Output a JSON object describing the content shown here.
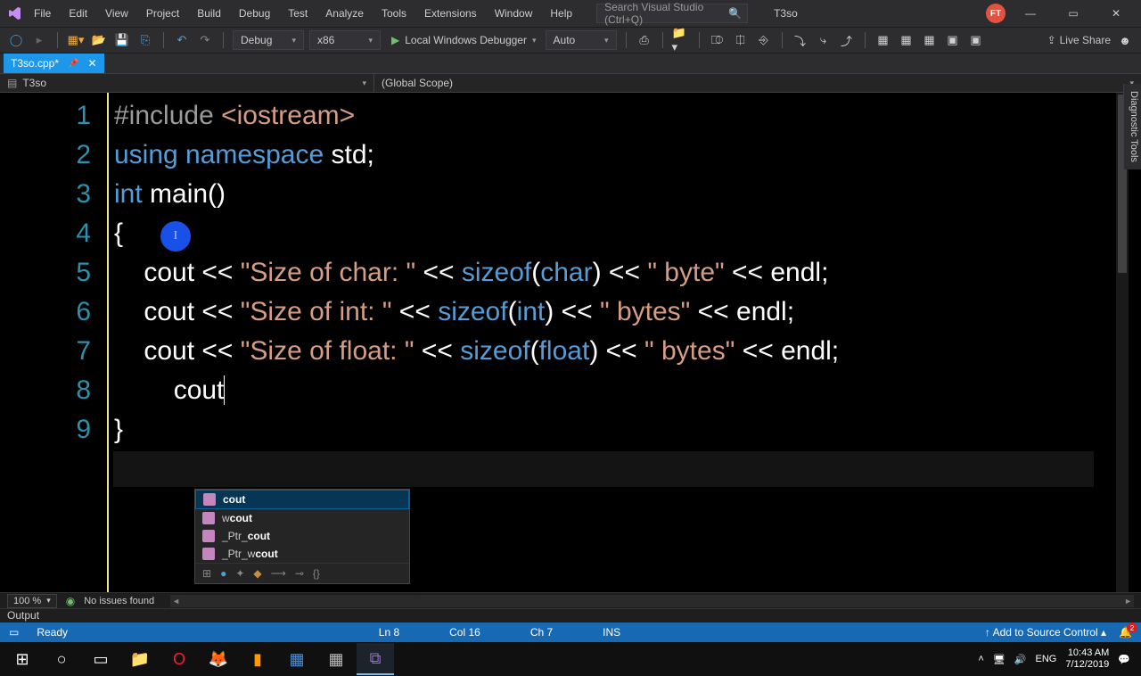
{
  "menu": {
    "items": [
      "File",
      "Edit",
      "View",
      "Project",
      "Build",
      "Debug",
      "Test",
      "Analyze",
      "Tools",
      "Extensions",
      "Window",
      "Help"
    ]
  },
  "search": {
    "placeholder": "Search Visual Studio (Ctrl+Q)"
  },
  "project_name": "T3so",
  "avatar_initials": "FT",
  "toolbar": {
    "config": "Debug",
    "platform": "x86",
    "debugger": "Local Windows Debugger",
    "auto": "Auto",
    "liveshare": "Live Share"
  },
  "tab": {
    "filename": "T3so.cpp*"
  },
  "scope": {
    "project": "T3so",
    "func": "(Global Scope)"
  },
  "gutter": [
    "1",
    "2",
    "3",
    "4",
    "5",
    "6",
    "7",
    "8",
    "9"
  ],
  "code": {
    "l1a": "#include",
    "l1b": " <iostream>",
    "l2a": "using",
    "l2b": " namespace",
    "l2c": " std;",
    "l3a": "int",
    "l3b": " main()",
    "l4": "{",
    "l5i": "    ",
    "l5a": "cout << ",
    "l5s": "\"Size of char: \"",
    "l5b": " << ",
    "l5k": "sizeof",
    "l5c": "(",
    "l5t": "char",
    "l5d": ") << ",
    "l5s2": "\" byte\"",
    "l5e": " << endl;",
    "l6i": "    ",
    "l6a": "cout << ",
    "l6s": "\"Size of int: \"",
    "l6b": " << ",
    "l6k": "sizeof",
    "l6c": "(",
    "l6t": "int",
    "l6d": ") << ",
    "l6s2": "\" bytes\"",
    "l6e": " << endl;",
    "l7i": "    ",
    "l7a": "cout << ",
    "l7s": "\"Size of float: \"",
    "l7b": " << ",
    "l7k": "sizeof",
    "l7c": "(",
    "l7t": "float",
    "l7d": ") << ",
    "l7s2": "\" bytes\"",
    "l7e": " << endl;",
    "l8i": "        ",
    "l8a": "cout",
    "l9": "}"
  },
  "intellisense": {
    "items": [
      {
        "pre": "",
        "match": "cout",
        "post": ""
      },
      {
        "pre": "w",
        "match": "cout",
        "post": ""
      },
      {
        "pre": "_Ptr_",
        "match": "cout",
        "post": ""
      },
      {
        "pre": "_Ptr_w",
        "match": "cout",
        "post": ""
      }
    ]
  },
  "zoom": "100 %",
  "issues": "No issues found",
  "output_label": "Output",
  "status": {
    "ready": "Ready",
    "ln": "Ln 8",
    "col": "Col 16",
    "ch": "Ch 7",
    "ins": "INS",
    "add": "Add to Source Control"
  },
  "tray": {
    "lang": "ENG",
    "time": "10:43 AM",
    "date": "7/12/2019",
    "bell_count": "2"
  },
  "sidetab": "Diagnostic Tools"
}
